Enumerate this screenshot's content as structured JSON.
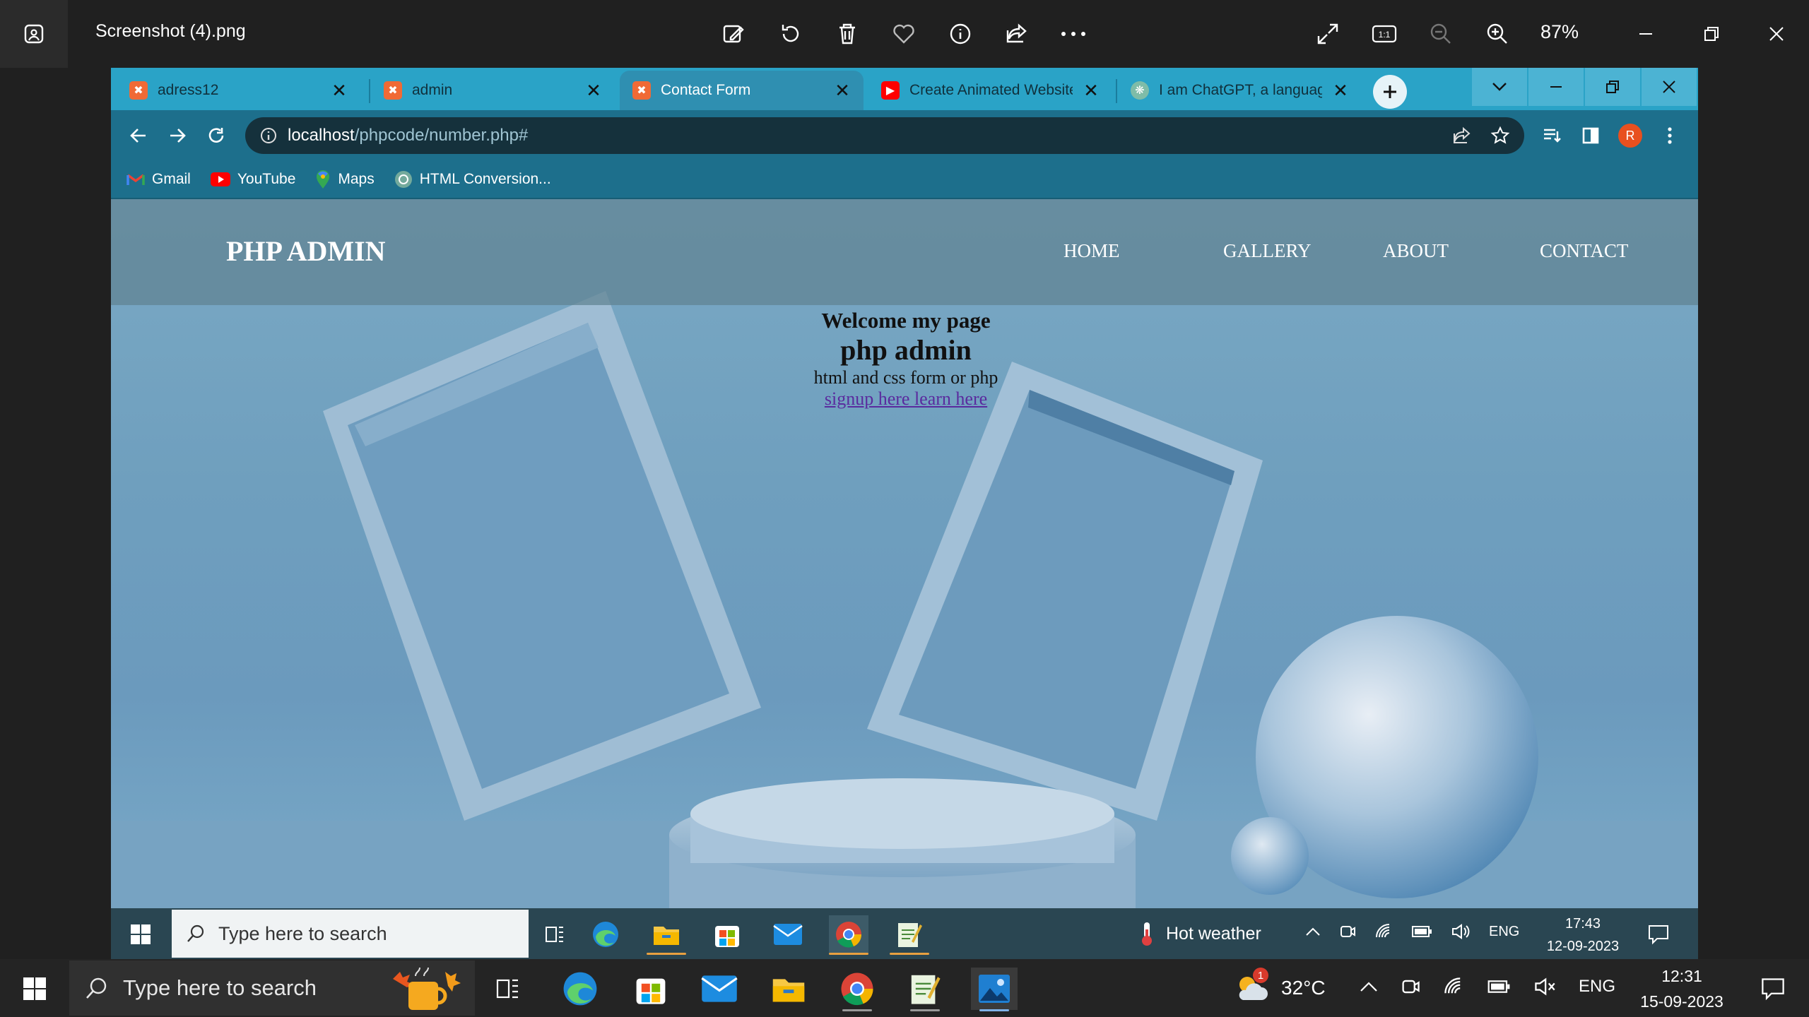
{
  "viewer": {
    "title": "Screenshot (4).png",
    "zoom": "87%",
    "toolbar": [
      "edit-image-icon",
      "rotate-icon",
      "delete-icon",
      "favorite-icon",
      "info-icon",
      "share-icon",
      "more-icon"
    ],
    "right_tools": [
      "fullscreen-icon",
      "actual-size-icon",
      "zoom-out-icon",
      "zoom-in-icon"
    ]
  },
  "browser": {
    "tabs": [
      {
        "label": "adress12",
        "favicon": "xampp-icon",
        "active": false
      },
      {
        "label": "admin",
        "favicon": "xampp-icon",
        "active": false
      },
      {
        "label": "Contact Form",
        "favicon": "xampp-icon",
        "active": true
      },
      {
        "label": "Create Animated Website",
        "favicon": "youtube-icon",
        "active": false
      },
      {
        "label": "I am ChatGPT, a language",
        "favicon": "chatgpt-icon",
        "active": false
      }
    ],
    "url_host": "localhost",
    "url_path": "/phpcode/number.php#",
    "profile_initial": "R",
    "bookmarks": [
      {
        "label": "Gmail",
        "icon": "gmail-icon"
      },
      {
        "label": "YouTube",
        "icon": "youtube-icon"
      },
      {
        "label": "Maps",
        "icon": "maps-icon"
      },
      {
        "label": "HTML Conversion...",
        "icon": "chatgpt-icon"
      }
    ]
  },
  "site": {
    "brand": "PHP ADMIN",
    "nav": [
      "HOME",
      "GALLERY",
      "ABOUT",
      "CONTACT"
    ],
    "hero": {
      "welcome": "Welcome my page",
      "title": "php admin",
      "subtitle": "html and css form or php",
      "link": "signup here learn here"
    }
  },
  "inner_taskbar": {
    "search_placeholder": "Type here to search",
    "weather": "Hot weather",
    "lang": "ENG",
    "time": "17:43",
    "date": "12-09-2023"
  },
  "taskbar": {
    "search_placeholder": "Type here to search",
    "temperature": "32°C",
    "weather_badge": "1",
    "lang": "ENG",
    "time": "12:31",
    "date": "15-09-2023"
  },
  "colors": {
    "accent": "#2aa3c7",
    "toolbar": "#1d6f8c",
    "link": "#5a2b9e",
    "profile": "#e8501f"
  }
}
